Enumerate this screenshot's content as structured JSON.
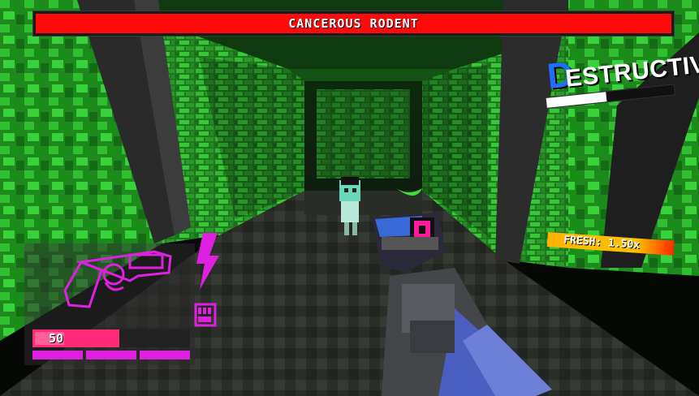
{
  "boss": {
    "name": "CANCEROUS RODENT",
    "health_fraction": 1.0
  },
  "style": {
    "rank_initial": "D",
    "rank_rest": "ESTRUCTIVE",
    "meter_fraction": 0.47
  },
  "freshness": {
    "label": "FRESH: 1.50x"
  },
  "player": {
    "health": "50",
    "health_fraction": 0.55,
    "stamina_pips": 3
  },
  "weapon": {
    "icon": "revolver-icon"
  },
  "ability": {
    "icon": "lightning-icon",
    "fist_icon": "fist-icon"
  },
  "colors": {
    "boss_bar": "#ff0a0a",
    "rank_accent": "#1e6fff",
    "health": "#ff2a77",
    "hud_magenta": "#e020e0",
    "wall_green": "#2fbf2f"
  }
}
